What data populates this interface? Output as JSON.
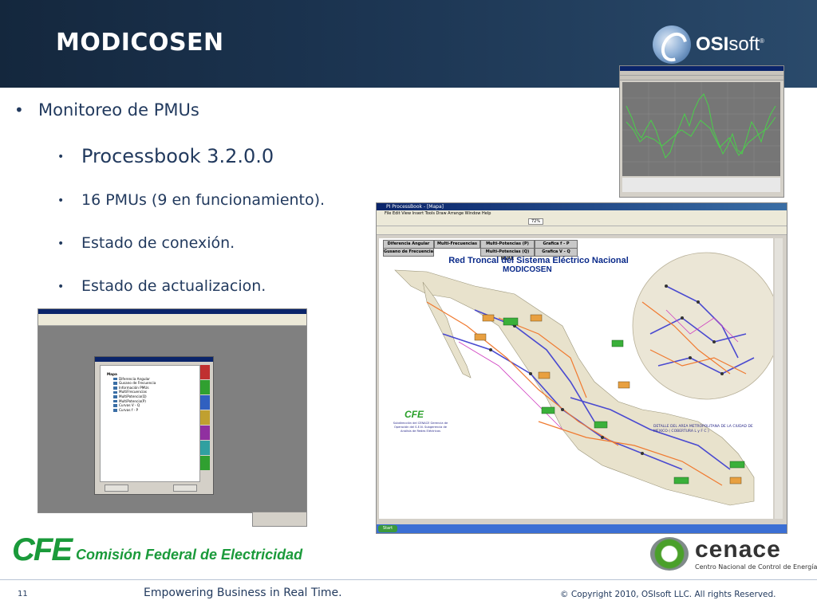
{
  "slide": {
    "title": "MODICOSEN",
    "brand": {
      "osi_bold": "OSI",
      "osi_light": "soft",
      "osi_reg": "®"
    },
    "bullets": {
      "level1": "Monitoreo de PMUs",
      "level2": [
        "Processbook 3.2.0.0",
        "16 PMUs (9 en funcionamiento).",
        "Estado de conexión.",
        "Estado de actualizacion."
      ]
    },
    "footer": {
      "page_number": "11",
      "tagline": "Empowering Business in Real Time.",
      "copyright": "© Copyright 2010, OSIsoft LLC.  All rights Reserved."
    },
    "logos": {
      "cfe_mark": "CFE",
      "cfe_name": "Comisión Federal de Electricidad",
      "cenace_name": "cenace",
      "cenace_sub": "Centro Nacional de Control de Energía"
    }
  },
  "processbook_window": {
    "title": "PI ProcessBook - [Mapa]",
    "menu": "File  Edit  View  Insert  Tools  Draw  Arrange  Window  Help",
    "nav_buttons": [
      "Diferencia Angular",
      "Multi-Frecuencias",
      "Multi-Potencias (P) MW",
      "Grafica f - P",
      "Gusano de Frecuencia",
      "Multi-Potencias (Q) MVAR",
      "Grafica V - Q"
    ],
    "map_title": "Red Troncal del Sistema Eléctrico Nacional",
    "map_subtitle": "MODICOSEN",
    "area_label": "DETALLE DEL AREA METROPOLITANA DE LA CIUDAD DE MEXICO ( COBERTURA  L y F C )",
    "cfe_mini": "CFE",
    "cfe_mini_text": "Subdirección del CENACE Gerencia de Operación del S.E.N. Subgerencia de Análisis de Redes Eléctricas",
    "taskbar_start": "Start",
    "zoom": "72%"
  },
  "small_window": {
    "tree_root": "Mapa",
    "tree_items": [
      "Diferencia Angular",
      "Gusano de Frecuencia",
      "Información PMUs",
      "MultiFrecuencias",
      "MultiPotencia(Q)",
      "MultiPotencia(P)",
      "Curvas V - Q",
      "Curvas f - P"
    ]
  },
  "colors": {
    "header_bg": "#1c3552",
    "bullet_text": "#223a5e",
    "cfe_green": "#1a9a3a",
    "map_title_blue": "#0a2a8a"
  }
}
